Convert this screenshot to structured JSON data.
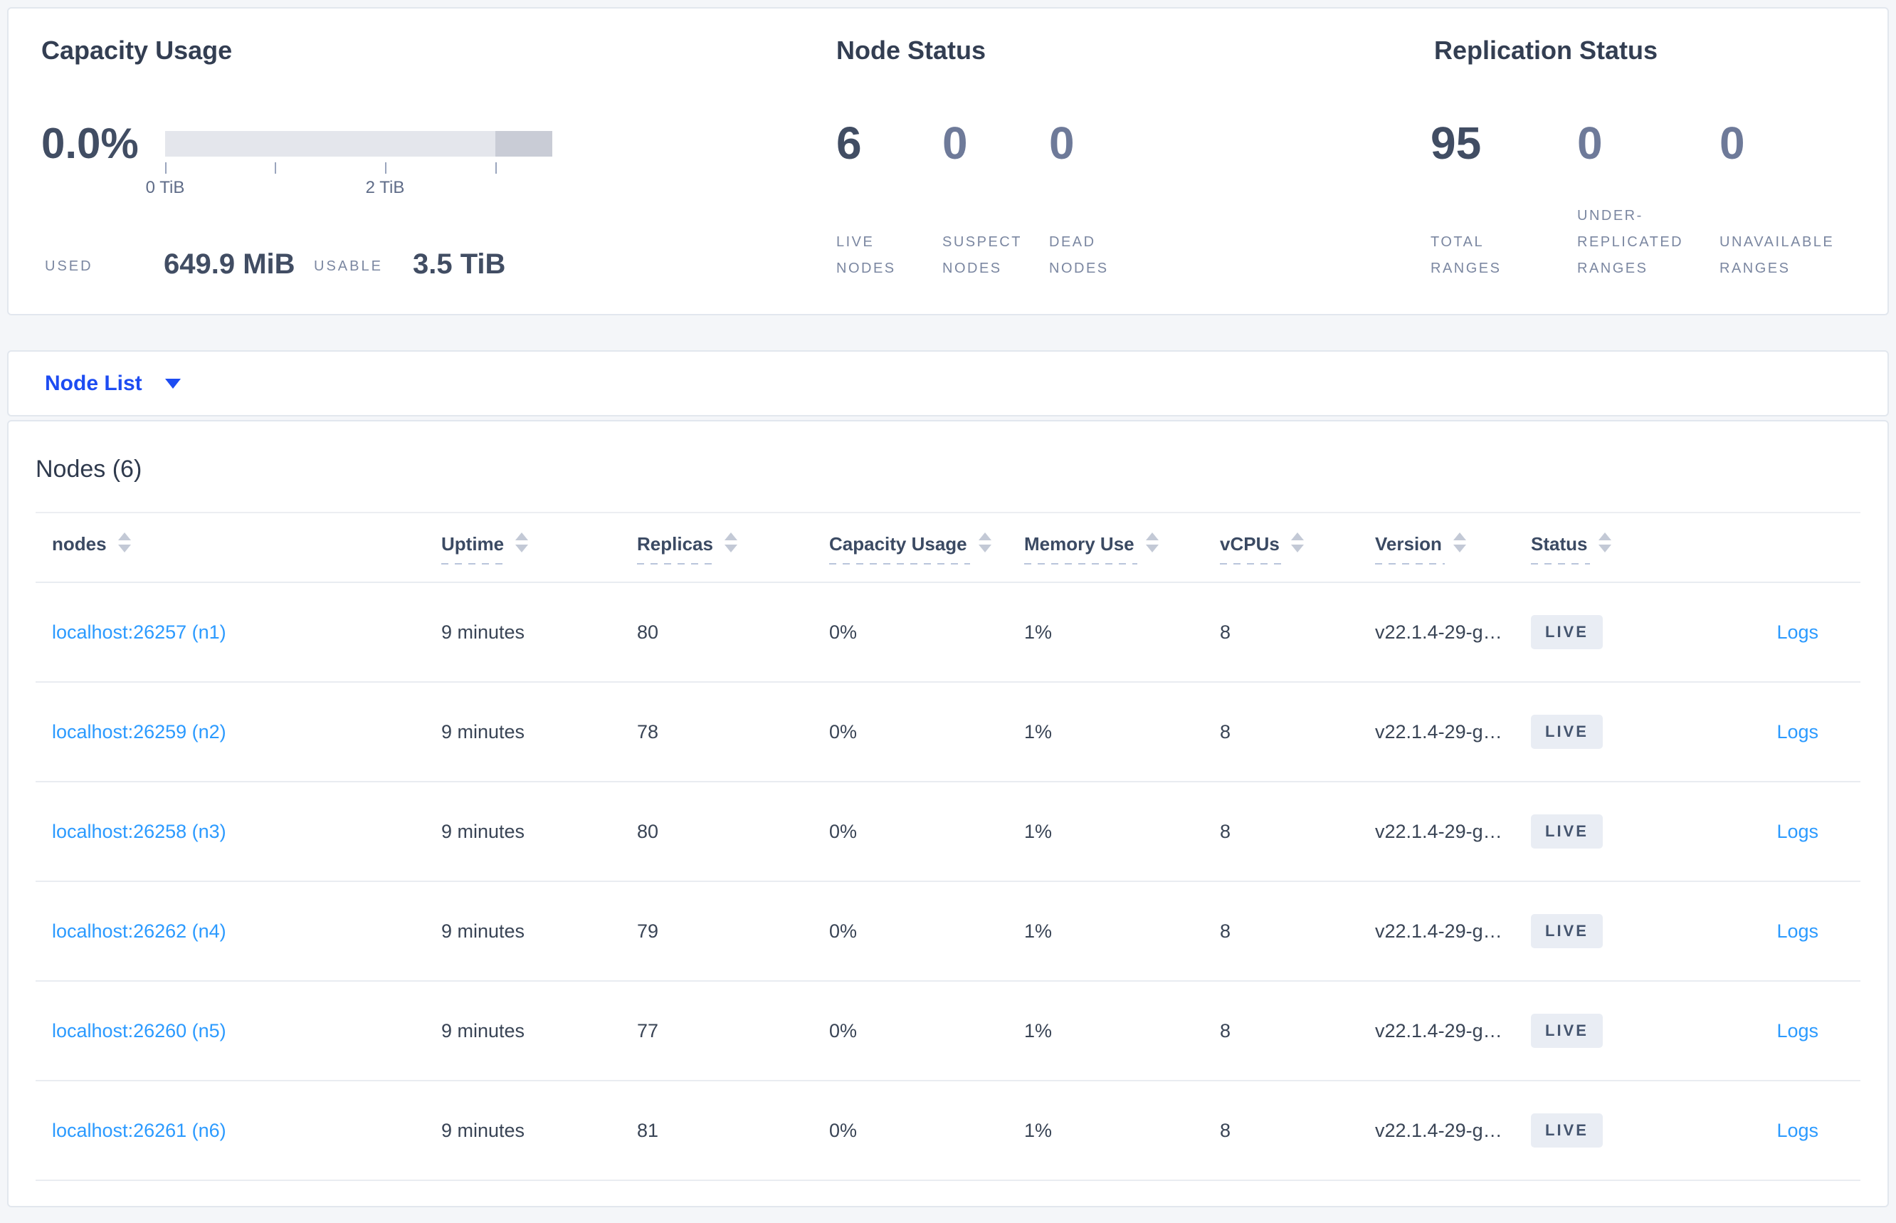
{
  "colors": {
    "link_blue": "#2b9aff",
    "selector_blue": "#1d4cf2",
    "dark_text": "#414d63",
    "muted_label": "#7b87a1",
    "badge_bg": "#e9edf4",
    "bar_light": "#e4e6ec",
    "bar_dark": "#c9ccd6"
  },
  "capacity": {
    "title": "Capacity Usage",
    "percent": "0.0%",
    "axis_ticks": [
      {
        "offset": 0,
        "label": "0 TiB"
      },
      {
        "offset": 154,
        "label": ""
      },
      {
        "offset": 309,
        "label": "2 TiB"
      },
      {
        "offset": 464,
        "label": ""
      }
    ],
    "used_label": "USED",
    "used_value": "649.9 MiB",
    "usable_label": "USABLE",
    "usable_value": "3.5 TiB"
  },
  "node_status": {
    "title": "Node Status",
    "metrics": [
      {
        "value": "6",
        "label": "LIVE NODES"
      },
      {
        "value": "0",
        "label": "SUSPECT NODES"
      },
      {
        "value": "0",
        "label": "DEAD NODES"
      }
    ]
  },
  "replication_status": {
    "title": "Replication Status",
    "metrics": [
      {
        "value": "95",
        "label": "TOTAL RANGES"
      },
      {
        "value": "0",
        "label": "UNDER-REPLICATED RANGES"
      },
      {
        "value": "0",
        "label": "UNAVAILABLE RANGES"
      }
    ]
  },
  "view_selector": {
    "label": "Node List"
  },
  "nodes_table": {
    "title": "Nodes (6)",
    "columns": [
      {
        "label": "nodes",
        "style": "plain"
      },
      {
        "label": "Uptime",
        "style": "dashed"
      },
      {
        "label": "Replicas",
        "style": "dashed"
      },
      {
        "label": "Capacity Usage",
        "style": "dashed"
      },
      {
        "label": "Memory Use",
        "style": "dashed"
      },
      {
        "label": "vCPUs",
        "style": "dashed"
      },
      {
        "label": "Version",
        "style": "dashed"
      },
      {
        "label": "Status",
        "style": "dashed"
      },
      {
        "label": "",
        "style": "empty"
      }
    ],
    "logs_label": "Logs",
    "rows": [
      {
        "node": "localhost:26257 (n1)",
        "uptime": "9 minutes",
        "replicas": "80",
        "capacity": "0%",
        "memory": "1%",
        "vcpus": "8",
        "version": "v22.1.4-29-g…",
        "status": "LIVE"
      },
      {
        "node": "localhost:26259 (n2)",
        "uptime": "9 minutes",
        "replicas": "78",
        "capacity": "0%",
        "memory": "1%",
        "vcpus": "8",
        "version": "v22.1.4-29-g…",
        "status": "LIVE"
      },
      {
        "node": "localhost:26258 (n3)",
        "uptime": "9 minutes",
        "replicas": "80",
        "capacity": "0%",
        "memory": "1%",
        "vcpus": "8",
        "version": "v22.1.4-29-g…",
        "status": "LIVE"
      },
      {
        "node": "localhost:26262 (n4)",
        "uptime": "9 minutes",
        "replicas": "79",
        "capacity": "0%",
        "memory": "1%",
        "vcpus": "8",
        "version": "v22.1.4-29-g…",
        "status": "LIVE"
      },
      {
        "node": "localhost:26260 (n5)",
        "uptime": "9 minutes",
        "replicas": "77",
        "capacity": "0%",
        "memory": "1%",
        "vcpus": "8",
        "version": "v22.1.4-29-g…",
        "status": "LIVE"
      },
      {
        "node": "localhost:26261 (n6)",
        "uptime": "9 minutes",
        "replicas": "81",
        "capacity": "0%",
        "memory": "1%",
        "vcpus": "8",
        "version": "v22.1.4-29-g…",
        "status": "LIVE"
      }
    ]
  }
}
